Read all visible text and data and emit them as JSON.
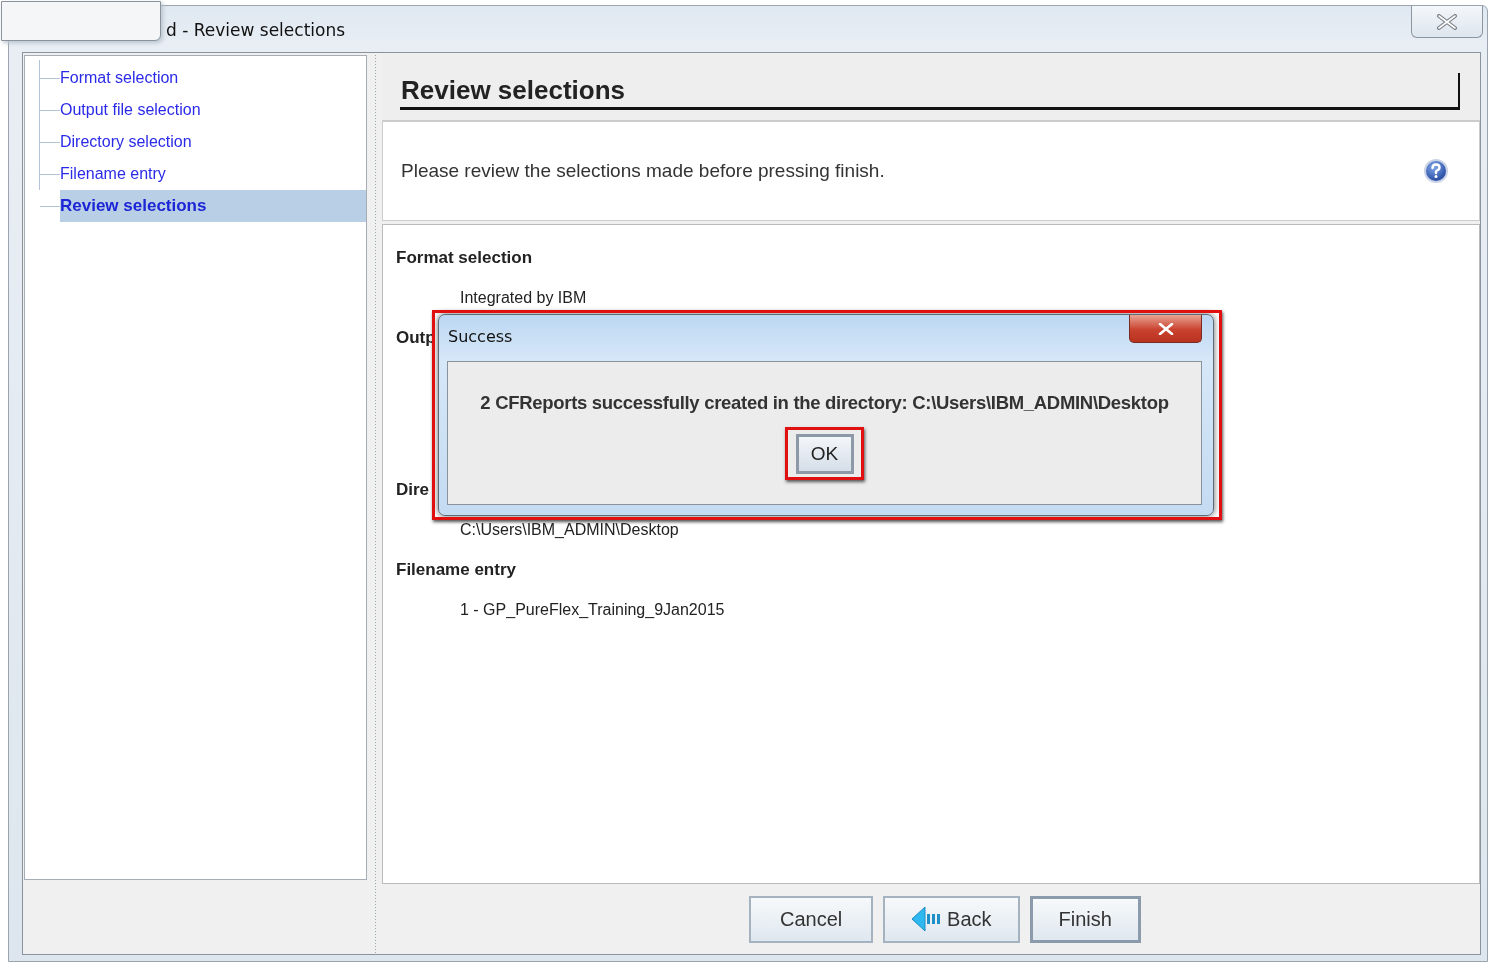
{
  "window": {
    "title": "d - Review selections"
  },
  "steps": [
    {
      "label": "Format selection",
      "selected": false
    },
    {
      "label": "Output file selection",
      "selected": false
    },
    {
      "label": "Directory selection",
      "selected": false
    },
    {
      "label": "Filename entry",
      "selected": false
    },
    {
      "label": "Review selections",
      "selected": true
    }
  ],
  "header": {
    "title": "Review selections"
  },
  "description": {
    "text": "Please review the selections made before pressing finish."
  },
  "review": {
    "sections": [
      {
        "heading": "Format selection",
        "values": [
          "Integrated by IBM"
        ]
      },
      {
        "heading": "Outp"
      },
      {
        "heading": "Dire",
        "values": [
          "C:\\Users\\IBM_ADMIN\\Desktop"
        ]
      },
      {
        "heading": "Filename entry",
        "values": [
          "1 - GP_PureFlex_Training_9Jan2015"
        ]
      }
    ]
  },
  "buttons": [
    {
      "label": "Cancel",
      "kind": "plain",
      "default": false
    },
    {
      "label": "Back",
      "kind": "back",
      "default": false
    },
    {
      "label": "Finish",
      "kind": "plain",
      "default": true
    }
  ],
  "dialog": {
    "title": "Success",
    "highlighted": true,
    "message": "2 CFReports successfully created in the directory: C:\\Users\\IBM_ADMIN\\Desktop",
    "button": {
      "label": "OK",
      "highlighted": true
    }
  }
}
